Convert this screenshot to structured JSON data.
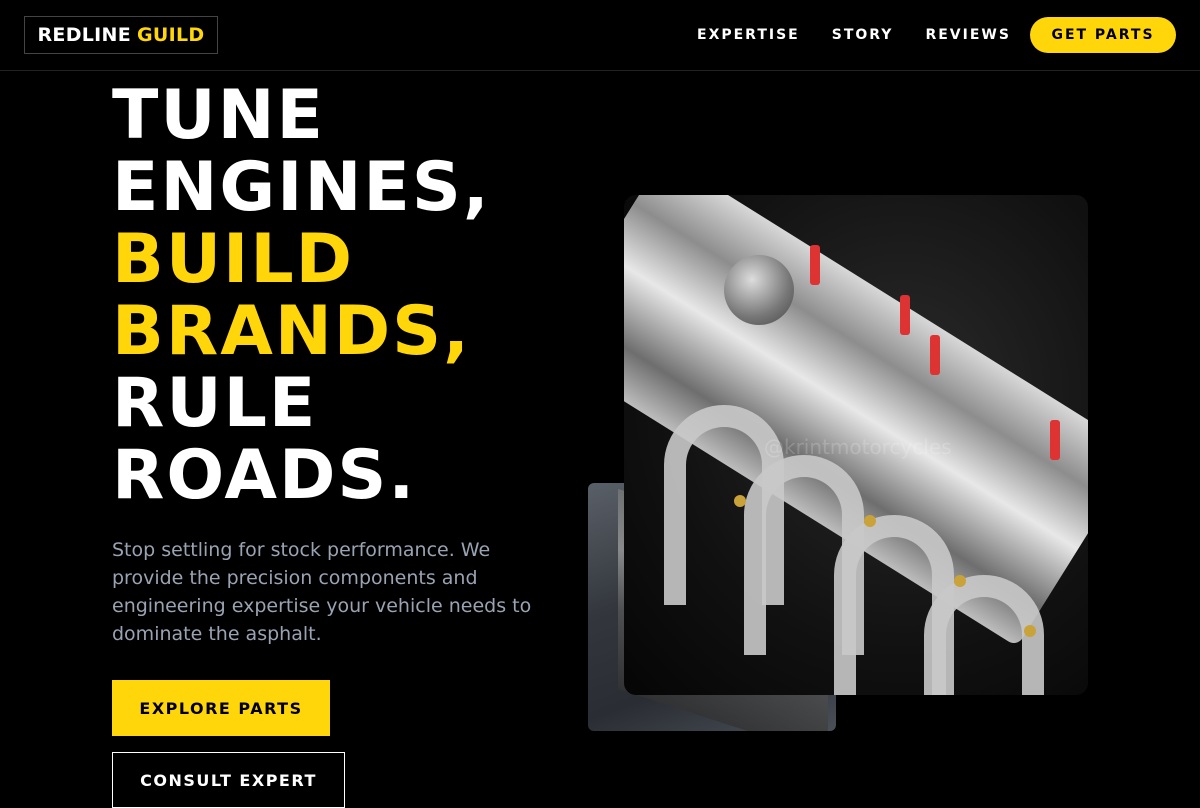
{
  "nav": {
    "logo_part1": "REDLINE",
    "logo_part2": "GUILD",
    "links": [
      "EXPERTISE",
      "STORY",
      "REVIEWS"
    ],
    "cta": "GET PARTS"
  },
  "hero": {
    "title_lines": [
      "TUNE",
      "ENGINES,",
      "BUILD",
      "BRANDS,",
      "RULE",
      "ROADS."
    ],
    "description": "Stop settling for stock performance. We provide the precision components and engineering expertise your vehicle needs to dominate the asphalt.",
    "primary_button": "EXPLORE PARTS",
    "secondary_button": "CONSULT EXPERT"
  },
  "media": {
    "main_image_icon": "engine-photo-icon",
    "back_image_icon": "engine-bay-photo-icon",
    "watermark": "@krintmotorcycles"
  },
  "colors": {
    "accent": "#FFD60A",
    "background": "#000000",
    "muted_text": "#9aa3b2"
  }
}
